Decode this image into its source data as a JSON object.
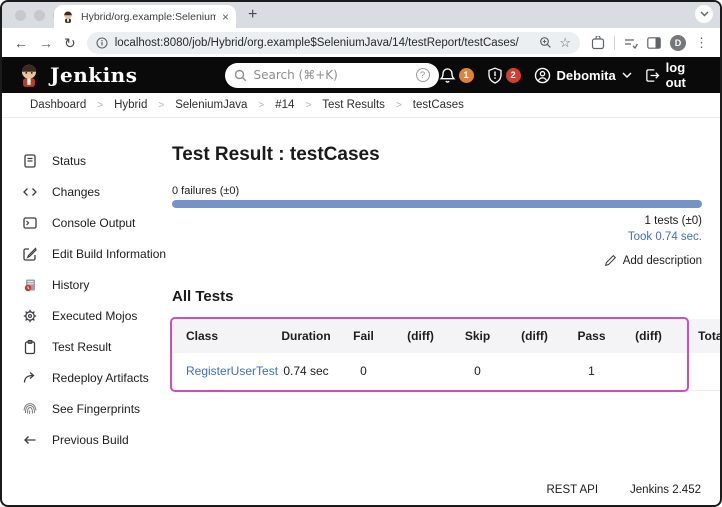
{
  "colors": {
    "accent_link": "#3d6ec9",
    "progress_bar": "#7494c6",
    "highlight_border": "#d04eb5",
    "badge_orange": "#df8337",
    "badge_red": "#d23f31"
  },
  "icons": {
    "new_tab": "+",
    "close_tab": "×",
    "back": "←",
    "forward": "→",
    "reload": "↻",
    "star": "☆",
    "menu_dots": "⋮",
    "help": "?",
    "breadcrumb_separator": ">"
  },
  "browser": {
    "tab_title": "Hybrid/org.example:Selenium",
    "url": "localhost:8080/job/Hybrid/org.example$SeleniumJava/14/testReport/testCases/",
    "profile_initial": "D"
  },
  "header": {
    "brand": "Jenkins",
    "search_placeholder": "Search (⌘+K)",
    "bell_badge": "1",
    "shield_badge": "2",
    "user_name": "Debomita",
    "logout_label": "log out"
  },
  "breadcrumb": {
    "items": [
      "Dashboard",
      "Hybrid",
      "SeleniumJava",
      "#14",
      "Test Results",
      "testCases"
    ]
  },
  "sidebar": {
    "items": [
      {
        "label": "Status",
        "icon": "document-icon"
      },
      {
        "label": "Changes",
        "icon": "code-icon"
      },
      {
        "label": "Console Output",
        "icon": "terminal-icon"
      },
      {
        "label": "Edit Build Information",
        "icon": "edit-icon"
      },
      {
        "label": "History",
        "icon": "history-icon"
      },
      {
        "label": "Executed Mojos",
        "icon": "gear-icon"
      },
      {
        "label": "Test Result",
        "icon": "clipboard-icon"
      },
      {
        "label": "Redeploy Artifacts",
        "icon": "redeploy-arrow-icon"
      },
      {
        "label": "See Fingerprints",
        "icon": "fingerprint-icon"
      },
      {
        "label": "Previous Build",
        "icon": "arrow-left-icon"
      }
    ]
  },
  "main": {
    "title": "Test Result : testCases",
    "failures_label": "0 failures (±0)",
    "tests_label": "1 tests (±0)",
    "took_label": "Took 0.74 sec.",
    "add_description": "Add description",
    "all_tests_title": "All Tests"
  },
  "table": {
    "headers": [
      "Class",
      "Duration",
      "Fail",
      "(diff)",
      "Skip",
      "(diff)",
      "Pass",
      "(diff)",
      "Total"
    ],
    "row": {
      "class_name": "RegisterUserTest",
      "duration": "0.74 sec",
      "fail": "0",
      "fail_diff": "",
      "skip": "0",
      "skip_diff": "",
      "pass": "1",
      "pass_diff": "",
      "total": ""
    }
  },
  "footer": {
    "rest_api": "REST API",
    "version": "Jenkins 2.452"
  }
}
